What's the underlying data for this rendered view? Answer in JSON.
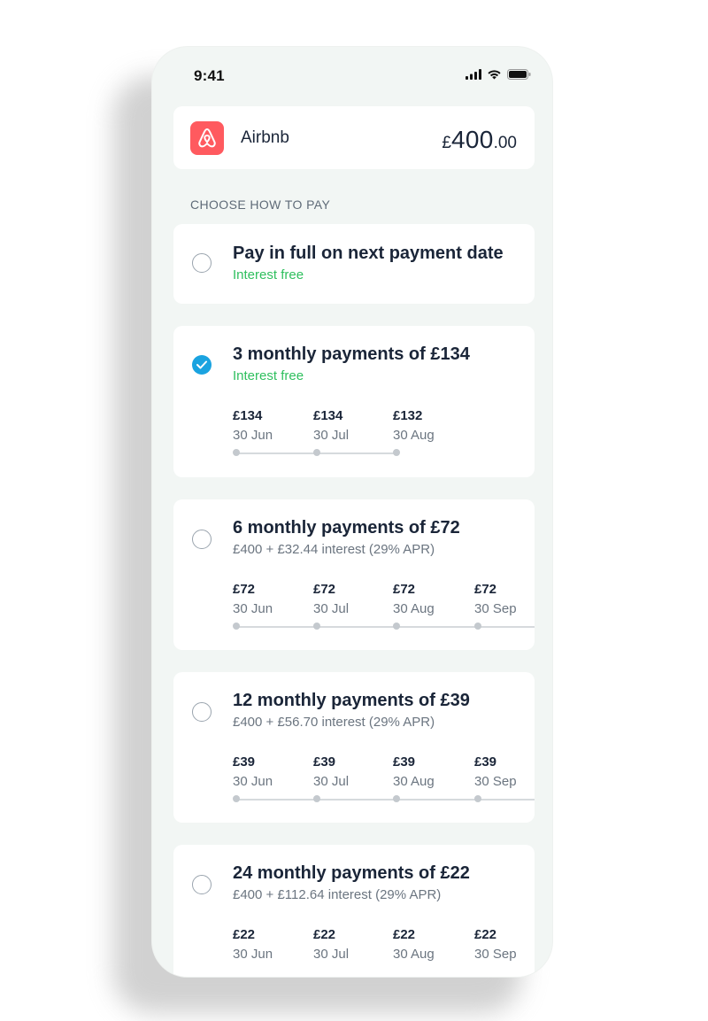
{
  "status": {
    "time": "9:41"
  },
  "merchant": {
    "name": "Airbnb",
    "amount_currency": "£",
    "amount_main": "400",
    "amount_decimal": ".00",
    "logo_color": "#FF5A5F"
  },
  "section_label": "CHOOSE HOW TO PAY",
  "options": [
    {
      "title": "Pay in full on next payment date",
      "subtitle": "Interest free",
      "selected": false,
      "installments": []
    },
    {
      "title": "3 monthly payments of £134",
      "subtitle": "Interest free",
      "selected": true,
      "installments": [
        {
          "amount": "£134",
          "date": "30 Jun"
        },
        {
          "amount": "£134",
          "date": "30 Jul"
        },
        {
          "amount": "£132",
          "date": "30 Aug"
        }
      ]
    },
    {
      "title": "6 monthly payments of £72",
      "subtitle": "£400 + £32.44 interest (29% APR)",
      "selected": false,
      "installments": [
        {
          "amount": "£72",
          "date": "30 Jun"
        },
        {
          "amount": "£72",
          "date": "30 Jul"
        },
        {
          "amount": "£72",
          "date": "30 Aug"
        },
        {
          "amount": "£72",
          "date": "30 Sep"
        }
      ]
    },
    {
      "title": "12 monthly payments of £39",
      "subtitle": "£400 + £56.70 interest (29% APR)",
      "selected": false,
      "installments": [
        {
          "amount": "£39",
          "date": "30 Jun"
        },
        {
          "amount": "£39",
          "date": "30 Jul"
        },
        {
          "amount": "£39",
          "date": "30 Aug"
        },
        {
          "amount": "£39",
          "date": "30 Sep"
        }
      ]
    },
    {
      "title": "24 monthly payments of £22",
      "subtitle": "£400 + £112.64 interest (29% APR)",
      "selected": false,
      "installments": [
        {
          "amount": "£22",
          "date": "30 Jun"
        },
        {
          "amount": "£22",
          "date": "30 Jul"
        },
        {
          "amount": "£22",
          "date": "30 Aug"
        },
        {
          "amount": "£22",
          "date": "30 Sep"
        }
      ]
    }
  ],
  "colors": {
    "accent": "#1AA3E0",
    "interest_free": "#2FBF5E",
    "text": "#1A2538",
    "muted": "#6B7580"
  }
}
